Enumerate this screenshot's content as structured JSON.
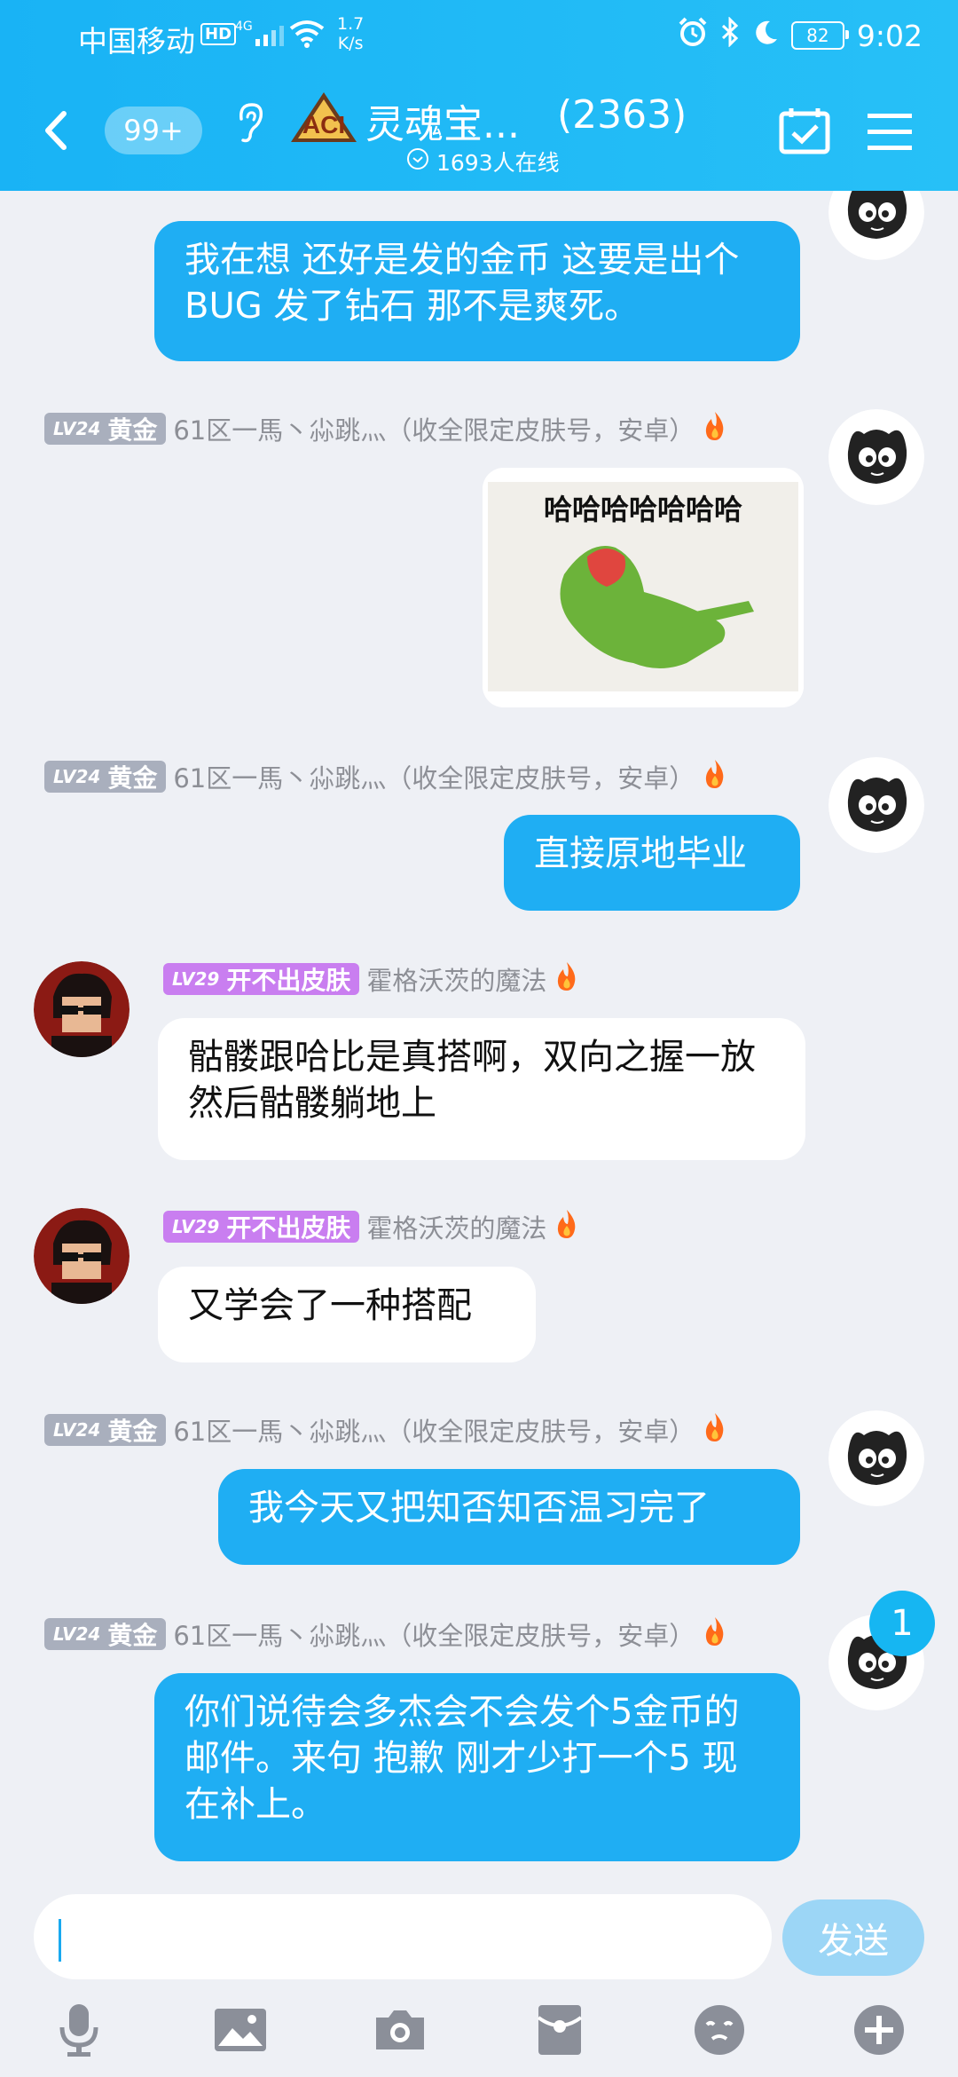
{
  "status": {
    "carrier": "中国移动",
    "hd": "HD",
    "net": "4G",
    "speed_value": "1.7",
    "speed_unit": "K/s",
    "battery": "82",
    "time": "9:02"
  },
  "header": {
    "unread_badge": "99+",
    "group_name": "灵魂宝...",
    "member_count": "(2363)",
    "online": "1693人在线",
    "logo_text": "ACI"
  },
  "messages": [
    {
      "id": 1,
      "side": "right",
      "text": "我在想 还好是发的金币 这要是出个BUG 发了钻石 那不是爽死。"
    },
    {
      "id": 2,
      "side": "right",
      "level": "LV24",
      "tag": "黄金",
      "name": "61区一馬丶尛跳灬（收全限定皮肤号，安卓）",
      "image_text": "哈哈哈哈哈哈哈"
    },
    {
      "id": 3,
      "side": "right",
      "level": "LV24",
      "tag": "黄金",
      "name": "61区一馬丶尛跳灬（收全限定皮肤号，安卓）",
      "text": "直接原地毕业"
    },
    {
      "id": 4,
      "side": "left",
      "level": "LV29",
      "tag": "开不出皮肤",
      "name": "霍格沃茨的魔法",
      "text": "骷髅跟哈比是真搭啊，双向之握一放然后骷髅躺地上"
    },
    {
      "id": 5,
      "side": "left",
      "level": "LV29",
      "tag": "开不出皮肤",
      "name": "霍格沃茨的魔法",
      "text": "又学会了一种搭配"
    },
    {
      "id": 6,
      "side": "right",
      "level": "LV24",
      "tag": "黄金",
      "name": "61区一馬丶尛跳灬（收全限定皮肤号，安卓）",
      "text": "我今天又把知否知否温习完了"
    },
    {
      "id": 7,
      "side": "right",
      "level": "LV24",
      "tag": "黄金",
      "name": "61区一馬丶尛跳灬（收全限定皮肤号，安卓）",
      "text": "你们说待会多杰会不会发个5金币的邮件。来句 抱歉 刚才少打一个5 现在补上。"
    }
  ],
  "unread_new": "1",
  "input": {
    "value": "",
    "send_label": "发送"
  },
  "toolbar": [
    "microphone-icon",
    "image-icon",
    "camera-icon",
    "red-packet-icon",
    "emoji-icon",
    "plus-icon"
  ],
  "colors": {
    "header": "#19b3f5",
    "my_bubble": "#1faef3",
    "send_disabled": "#9cd6f6",
    "lv24": "#a9afbd",
    "lv29": "#c97ef0"
  }
}
